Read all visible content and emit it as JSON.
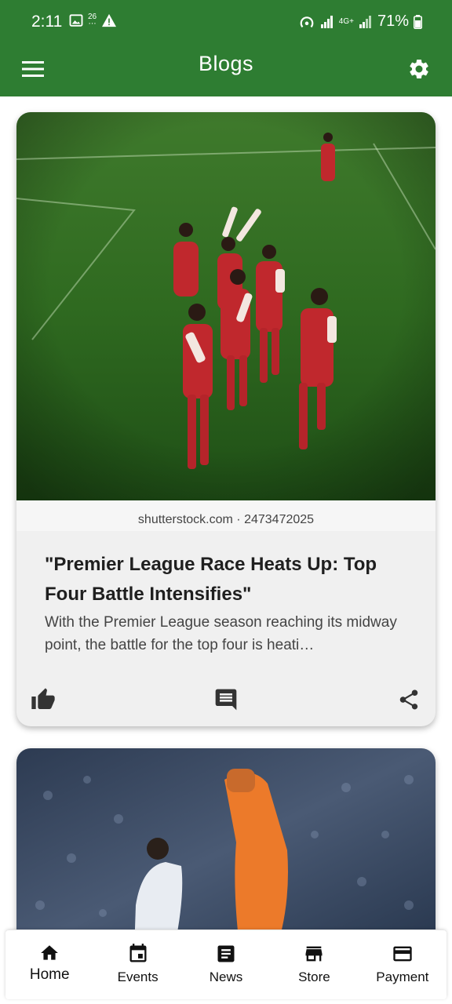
{
  "status_bar": {
    "time": "2:11",
    "notif_count": "26",
    "network": "4G+",
    "battery": "71%"
  },
  "app_bar": {
    "title": "Blogs",
    "color": "#2e7d32"
  },
  "posts": [
    {
      "image_watermark": "shutterstock.com · 2473472025",
      "title": "\"Premier League Race Heats Up: Top Four Battle Intensifies\"",
      "excerpt": "With the Premier League season reaching its midway point, the battle for the top four is heati…"
    },
    {
      "image_watermark": "",
      "title": "",
      "excerpt": ""
    }
  ],
  "bottom_nav": {
    "items": [
      {
        "label": "Home",
        "icon": "home-icon",
        "active": true
      },
      {
        "label": "Events",
        "icon": "calendar-icon",
        "active": false
      },
      {
        "label": "News",
        "icon": "article-icon",
        "active": false
      },
      {
        "label": "Store",
        "icon": "store-icon",
        "active": false
      },
      {
        "label": "Payment",
        "icon": "credit-card-icon",
        "active": false
      }
    ]
  }
}
